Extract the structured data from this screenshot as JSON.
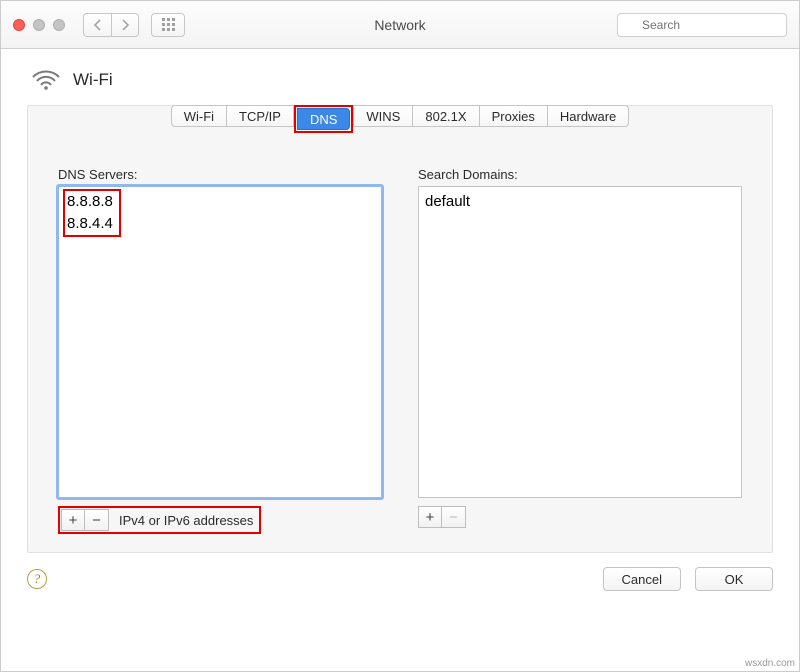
{
  "window": {
    "title": "Network"
  },
  "search": {
    "placeholder": "Search"
  },
  "header": {
    "label": "Wi-Fi"
  },
  "tabs": [
    {
      "label": "Wi-Fi",
      "active": false
    },
    {
      "label": "TCP/IP",
      "active": false
    },
    {
      "label": "DNS",
      "active": true
    },
    {
      "label": "WINS",
      "active": false
    },
    {
      "label": "802.1X",
      "active": false
    },
    {
      "label": "Proxies",
      "active": false
    },
    {
      "label": "Hardware",
      "active": false
    }
  ],
  "dns": {
    "label": "DNS Servers:",
    "entries": [
      "8.8.8.8",
      "8.8.4.4"
    ],
    "hint": "IPv4 or IPv6 addresses"
  },
  "domains": {
    "label": "Search Domains:",
    "entries": [
      "default"
    ]
  },
  "buttons": {
    "cancel": "Cancel",
    "ok": "OK",
    "plus": "+",
    "minus": "−"
  },
  "watermark": "wsxdn.com"
}
